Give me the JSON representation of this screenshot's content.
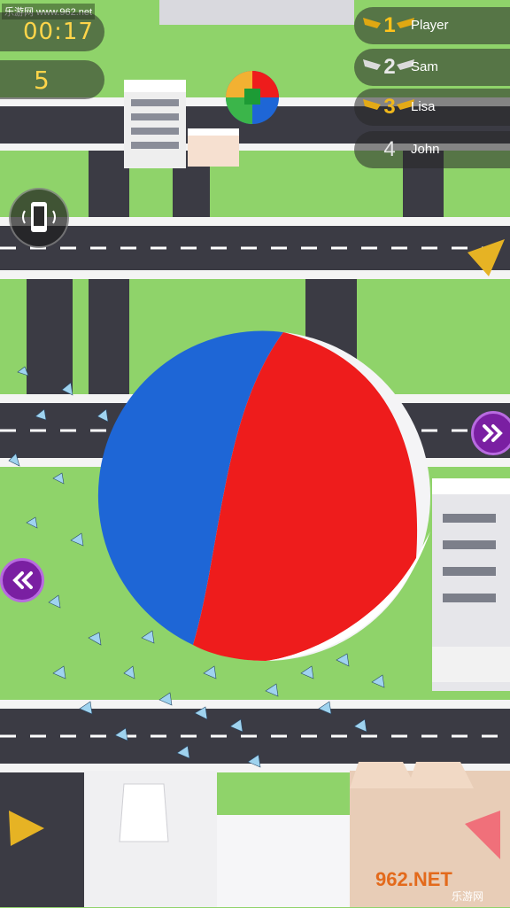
{
  "hud": {
    "timer": "00:17",
    "score": "5",
    "watermark": "乐游网 www.962.net"
  },
  "leaderboard": [
    {
      "rank": "1",
      "name": "Player",
      "tier": "gold"
    },
    {
      "rank": "2",
      "name": "Sam",
      "tier": "silver"
    },
    {
      "rank": "3",
      "name": "Lisa",
      "tier": "bronze"
    },
    {
      "rank": "4",
      "name": "John",
      "tier": "plain"
    }
  ],
  "controls": {
    "vibrate_icon": "phone-vibrate-icon",
    "right_icon": "double-chevron-right-icon",
    "left_icon": "double-chevron-left-icon"
  },
  "branding": {
    "logo_text": "962.NET",
    "logo_sub": "乐游网"
  },
  "colors": {
    "ball_red": "#ee1c1c",
    "ball_blue": "#1e66d6",
    "ground": "#8fd36a",
    "road": "#3b3b44",
    "accent_purple": "#7a1fa2"
  }
}
